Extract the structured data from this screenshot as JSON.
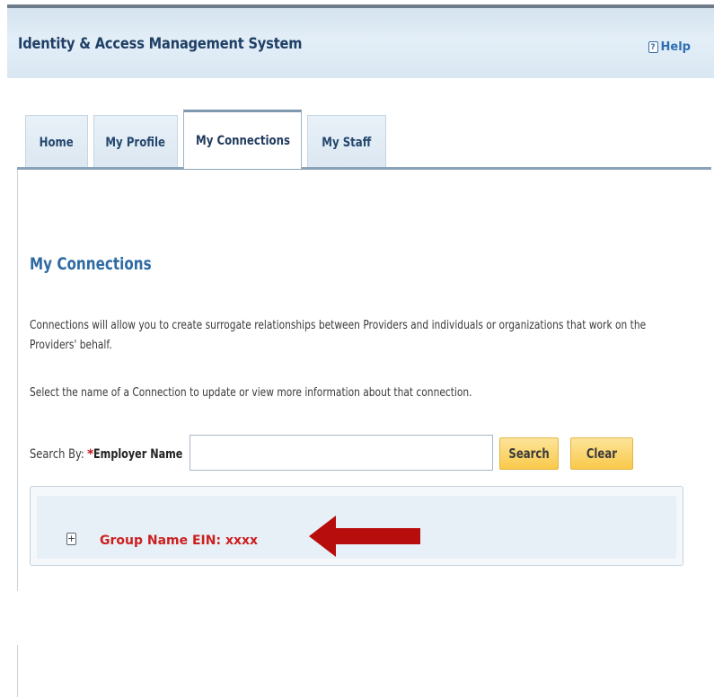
{
  "header": {
    "title": "Identity & Access Management System",
    "help_label": "Help",
    "help_icon_glyph": "?"
  },
  "tabs": [
    {
      "label": "Home",
      "active": false
    },
    {
      "label": "My Profile",
      "active": false
    },
    {
      "label": "My Connections",
      "active": true
    },
    {
      "label": "My Staff",
      "active": false
    }
  ],
  "main": {
    "section_title": "My Connections",
    "description": "Connections will allow you to create surrogate relationships between Providers and individuals or organizations that work on the Providers' behalf.",
    "instruction": "Select the name of a Connection to update or view more information about that connection.",
    "search": {
      "by_label": "Search By:",
      "required_marker": "*",
      "field_label": "Employer Name",
      "value": "",
      "search_button": "Search",
      "clear_button": "Clear"
    },
    "results": [
      {
        "label": "Group Name EIN: xxxx",
        "expand_glyph": "+"
      }
    ]
  },
  "colors": {
    "accent_title": "#2f6aa3",
    "button_fill": "#f9c94a",
    "result_text": "#cc1f1f",
    "arrow": "#b80d0d"
  },
  "icons": {
    "help": "help-icon",
    "expand": "plus-box-icon",
    "pointer": "left-arrow-icon"
  }
}
